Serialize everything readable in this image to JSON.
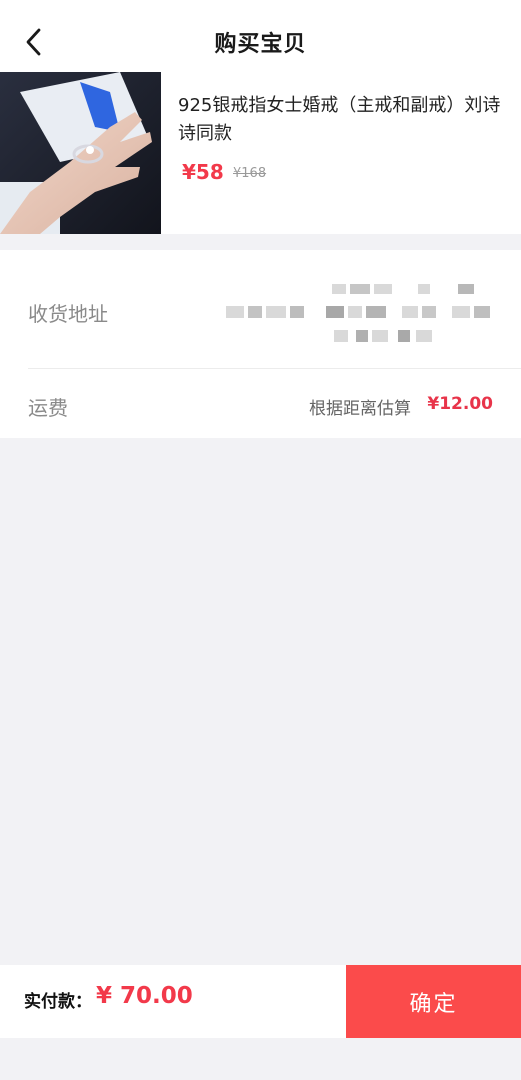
{
  "header": {
    "title": "购买宝贝",
    "back_icon": "chevron-left-icon"
  },
  "product": {
    "title": "925银戒指女士婚戒（主戒和副戒）刘诗诗同款",
    "price_now": "¥58",
    "price_old": "¥168",
    "image": "product-photo-ring-on-hand"
  },
  "delivery": {
    "address_label": "收货地址",
    "shipping_label": "运费",
    "shipping_note": "根据距离估算",
    "shipping_fee": "¥12.00"
  },
  "footer": {
    "total_label": "实付款：",
    "total_value": "¥ 70.00",
    "confirm_label": "确定"
  },
  "colors": {
    "accent_red": "#f2394a",
    "button_red": "#fb4b4b",
    "background": "#f2f2f5"
  }
}
